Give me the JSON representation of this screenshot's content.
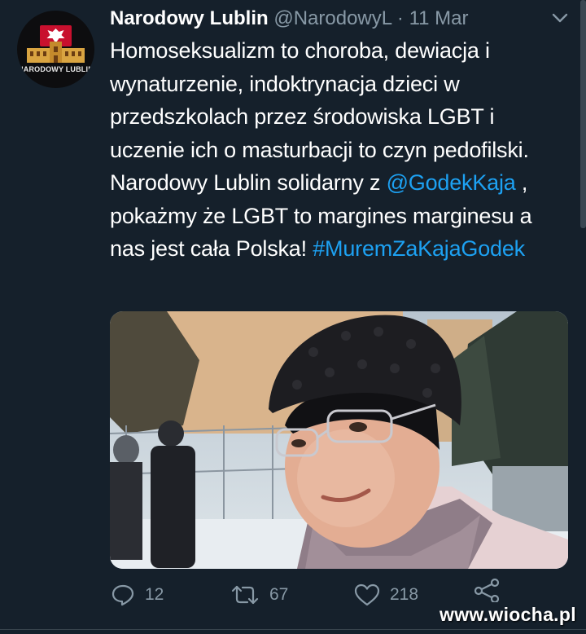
{
  "tweet": {
    "display_name": "Narodowy Lublin",
    "handle": "@NarodowyL",
    "separator": "·",
    "date": "11 Mar",
    "avatar_text": "NARODOWY LUBLIN",
    "text_part1": "Homoseksualizm to choroba, dewiacja i wynaturzenie, indoktrynacja dzieci w przedszkolach przez środowiska LGBT i uczenie ich o masturbacji to czyn pedofilski. Narodowy Lublin solidarny z ",
    "mention": "@GodekKaja",
    "text_part2": " , pokażmy że LGBT to margines marginesu a nas jest cała Polska! ",
    "hashtag": "#MuremZaKajaGodek"
  },
  "actions": {
    "replies": "12",
    "retweets": "67",
    "likes": "218"
  },
  "watermark": "www.wiocha.pl",
  "colors": {
    "background": "#15202b",
    "link": "#1da1f2",
    "muted": "#8899a6"
  }
}
